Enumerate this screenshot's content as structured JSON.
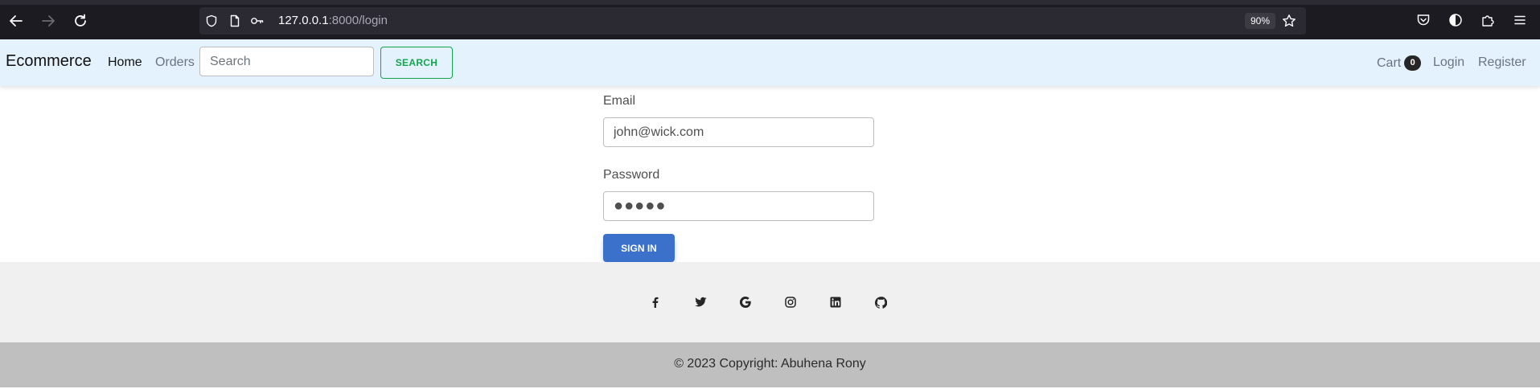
{
  "browser": {
    "url_host": "127.0.0.1",
    "url_rest": ":8000/login",
    "zoom": "90%"
  },
  "navbar": {
    "brand": "Ecommerce",
    "links": [
      "Home",
      "Orders"
    ],
    "search_placeholder": "Search",
    "search_button": "SEARCH",
    "cart_label": "Cart",
    "cart_count": "0",
    "login": "Login",
    "register": "Register"
  },
  "form": {
    "email_label": "Email",
    "email_value": "john@wick.com",
    "password_label": "Password",
    "password_value": "●●●●●",
    "submit": "SIGN IN"
  },
  "footer": {
    "social": [
      "facebook",
      "twitter",
      "google",
      "instagram",
      "linkedin",
      "github"
    ],
    "copyright": "© 2023 Copyright: Abuhena Rony"
  }
}
